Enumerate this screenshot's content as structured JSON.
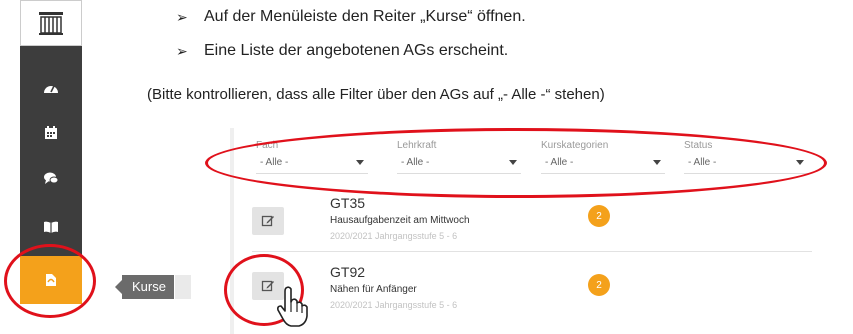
{
  "instructions": {
    "step1": "Auf der Menüleiste den Reiter „Kurse“ öffnen.",
    "step2": "Eine Liste der angebotenen AGs erscheint.",
    "note": "(Bitte kontrollieren, dass alle Filter über den AGs auf „- Alle -“ stehen)",
    "bullet_glyph": "➢"
  },
  "sidebar": {
    "icons": [
      "building-logo-icon",
      "dashboard-icon",
      "calendar-icon",
      "chat-icon",
      "book-icon",
      "courses-icon"
    ],
    "active_item": "courses-icon",
    "tooltip": "Kurse"
  },
  "filters": [
    {
      "label": "Fach",
      "value": "- Alle -"
    },
    {
      "label": "Lehrkraft",
      "value": "- Alle -"
    },
    {
      "label": "Kurskategorien",
      "value": "- Alle -"
    },
    {
      "label": "Status",
      "value": "- Alle -"
    }
  ],
  "courses": [
    {
      "code": "GT35",
      "name": "Hausaufgabenzeit am Mittwoch",
      "meta": "2020/2021 Jahrgangsstufe 5 - 6",
      "badge": "2"
    },
    {
      "code": "GT92",
      "name": "Nähen für Anfänger",
      "meta": "2020/2021 Jahrgangsstufe 5 - 6",
      "badge": "2"
    }
  ],
  "colors": {
    "accent": "#f4a11b",
    "sidebar": "#3d3d3d",
    "annotation": "#e0111b"
  }
}
